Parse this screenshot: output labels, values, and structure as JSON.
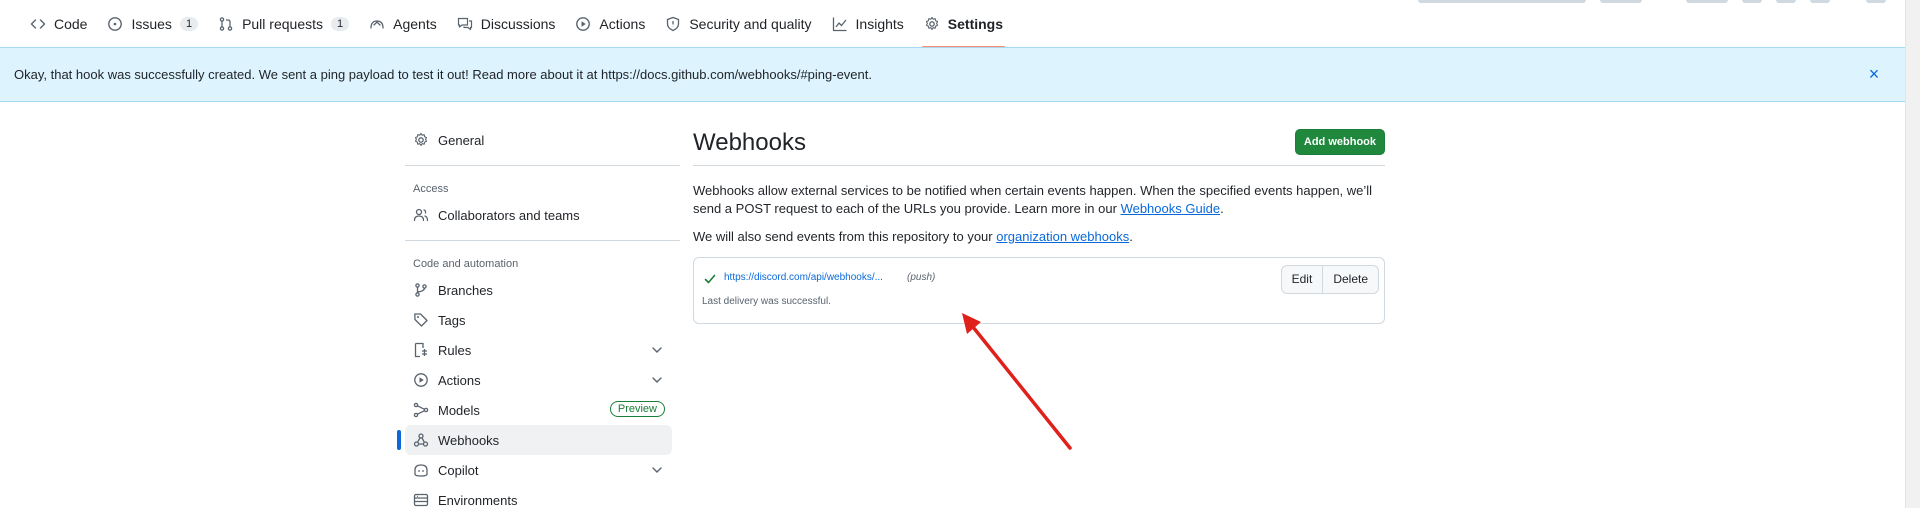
{
  "repo_nav": {
    "items": [
      {
        "label": "Code",
        "icon": "code-icon"
      },
      {
        "label": "Issues",
        "icon": "issue-icon",
        "count": "1"
      },
      {
        "label": "Pull requests",
        "icon": "pull-request-icon",
        "count": "1"
      },
      {
        "label": "Agents",
        "icon": "agents-icon"
      },
      {
        "label": "Discussions",
        "icon": "discussions-icon"
      },
      {
        "label": "Actions",
        "icon": "play-icon"
      },
      {
        "label": "Security and quality",
        "icon": "shield-icon"
      },
      {
        "label": "Insights",
        "icon": "graph-icon"
      },
      {
        "label": "Settings",
        "icon": "gear-icon",
        "selected": true
      }
    ]
  },
  "flash": {
    "message": "Okay, that hook was successfully created. We sent a ping payload to test it out! Read more about it at https://docs.github.com/webhooks/#ping-event.",
    "close": "×"
  },
  "sidebar": {
    "general": "General",
    "access_heading": "Access",
    "collaborators": "Collaborators and teams",
    "code_heading": "Code and automation",
    "branches": "Branches",
    "tags": "Tags",
    "rules": "Rules",
    "actions": "Actions",
    "models": "Models",
    "preview_badge": "Preview",
    "webhooks": "Webhooks",
    "copilot": "Copilot",
    "environments": "Environments"
  },
  "main": {
    "title": "Webhooks",
    "add_button": "Add webhook",
    "desc_part1": "Webhooks allow external services to be notified when certain events happen. When the specified events happen, we’ll send a POST request to each of the URLs you provide. Learn more in our ",
    "desc_link": "Webhooks Guide",
    "desc_part2": ".",
    "desc2_part1": "We will also send events from this repository to your ",
    "desc2_link": "organization webhooks",
    "desc2_part2": ".",
    "hook": {
      "url": "https://discord.com/api/webhooks/...",
      "event": "(push)",
      "status": "Last delivery was successful.",
      "edit": "Edit",
      "delete": "Delete"
    }
  },
  "colors": {
    "accent": "#0969da",
    "success": "#1f883d",
    "flash_bg": "#ddf4ff",
    "annotation": "#e0201a"
  }
}
